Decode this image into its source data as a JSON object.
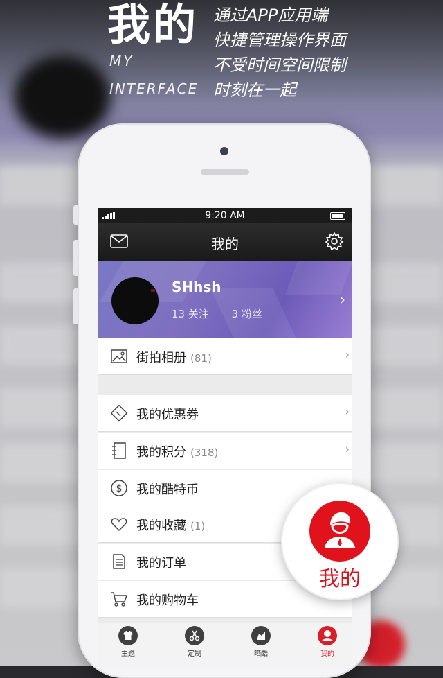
{
  "headline": {
    "title": "我的",
    "en_line1": "MY",
    "en_line2": "INTERFACE",
    "taglines": [
      "通过APP应用端",
      "快捷管理操作界面",
      "不受时间空间限制",
      "时刻在一起"
    ]
  },
  "status_bar": {
    "time": "9:20 AM"
  },
  "nav": {
    "title": "我的",
    "left_icon": "mail-icon",
    "right_icon": "gear-icon"
  },
  "profile": {
    "username": "SHhsh",
    "following": "13 关注",
    "followers": "3 粉丝"
  },
  "menu": [
    {
      "label": "街拍相册",
      "count": "(81)",
      "icon": "photo-album-icon"
    },
    {
      "label": "我的优惠券",
      "count": "",
      "icon": "coupon-icon"
    },
    {
      "label": "我的积分",
      "count": "(318)",
      "icon": "points-notebook-icon"
    },
    {
      "label": "我的酷特币",
      "count": "",
      "icon": "dollar-coin-icon"
    },
    {
      "label": "我的收藏",
      "count": "(1)",
      "icon": "heart-icon"
    },
    {
      "label": "我的订单",
      "count": "",
      "icon": "order-document-icon"
    },
    {
      "label": "我的购物车",
      "count": "",
      "icon": "shopping-cart-icon"
    }
  ],
  "tabs": [
    {
      "label": "主题",
      "icon": "tshirt-icon"
    },
    {
      "label": "定制",
      "icon": "scissors-icon"
    },
    {
      "label": "晒酷",
      "icon": "share-icon"
    },
    {
      "label": "我的",
      "icon": "user-icon",
      "active": true
    }
  ],
  "badge": {
    "label": "我的",
    "icon": "user-avatar-icon"
  },
  "colors": {
    "accent_red": "#d8202b",
    "nav_dark": "#1c1c1c",
    "profile_purple": "#7a78c4"
  }
}
